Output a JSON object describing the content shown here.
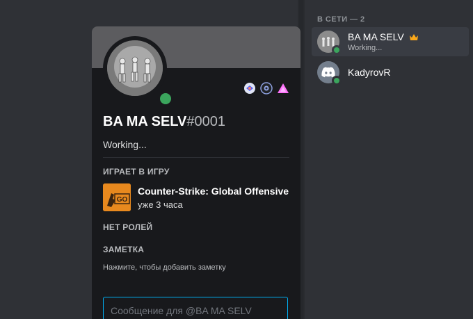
{
  "profile": {
    "username": "BA MA SELV",
    "discriminator": "#0001",
    "custom_status": "Working...",
    "playing_title": "ИГРАЕТ В ИГРУ",
    "game_name": "Counter-Strike: Global Offensive",
    "game_time": "уже 3 часа",
    "roles_title": "НЕТ РОЛЕЙ",
    "note_title": "ЗАМЕТКА",
    "note_placeholder": "Нажмите, чтобы добавить заметку",
    "message_placeholder": "Сообщение для @BA MA SELV",
    "game_icon_text": "GO",
    "badges": [
      "hypesquad-icon",
      "nitro-icon",
      "boost-icon"
    ]
  },
  "members": {
    "header": "В СЕТИ — 2",
    "items": [
      {
        "name": "BA MA SELV",
        "status": "Working...",
        "owner": true
      },
      {
        "name": "KadyrovR",
        "status": "",
        "owner": false
      }
    ]
  },
  "colors": {
    "online": "#3ba55d",
    "input_focus": "#00b0f4",
    "crown": "#faa81a"
  }
}
